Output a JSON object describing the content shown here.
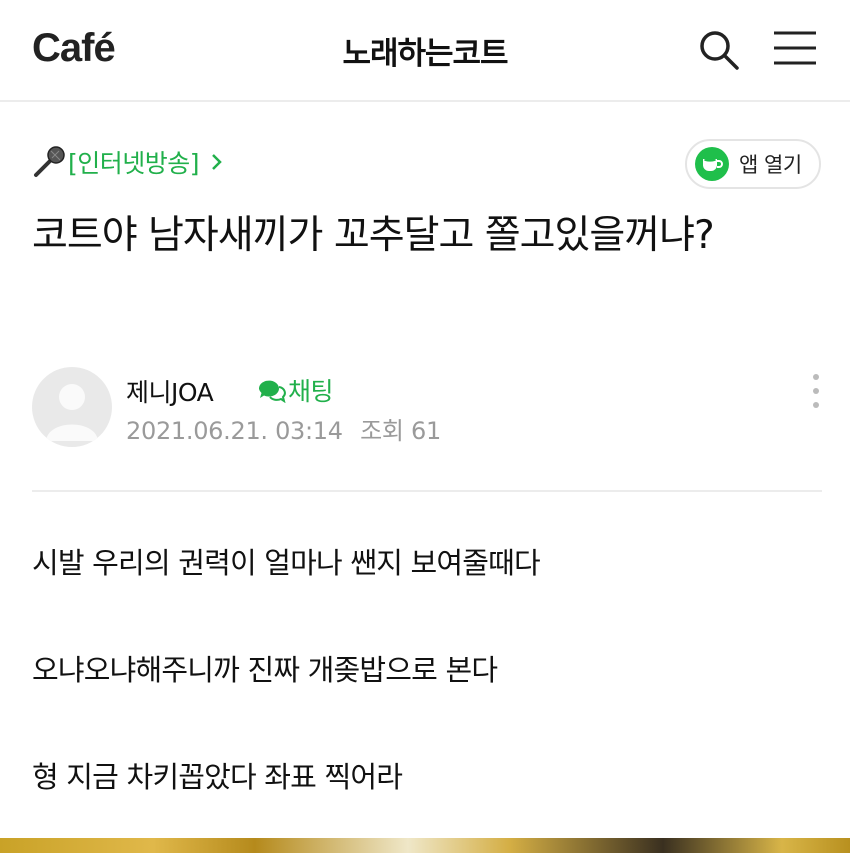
{
  "header": {
    "logo": "Café",
    "cafe_name": "노래하는코트"
  },
  "board": {
    "label": "[인터넷방송]",
    "icon": "microphone-icon"
  },
  "app_button": {
    "label": "앱 열기"
  },
  "post": {
    "title": "코트야 남자새끼가 꼬추달고 쫄고있을꺼냐?",
    "author": "제니JOA",
    "chat_label": "채팅",
    "date": "2021.06.21. 03:14",
    "views_label": "조회 61",
    "body": [
      "시발 우리의 권력이 얼마나 쌘지 보여줄때다",
      "오냐오냐해주니까 진짜 개좆밥으로 본다",
      "형 지금 차키꼽았다 좌표 찍어라"
    ]
  },
  "colors": {
    "accent_green": "#21b04b",
    "meta_gray": "#9a9a9a",
    "divider": "#ececec"
  }
}
